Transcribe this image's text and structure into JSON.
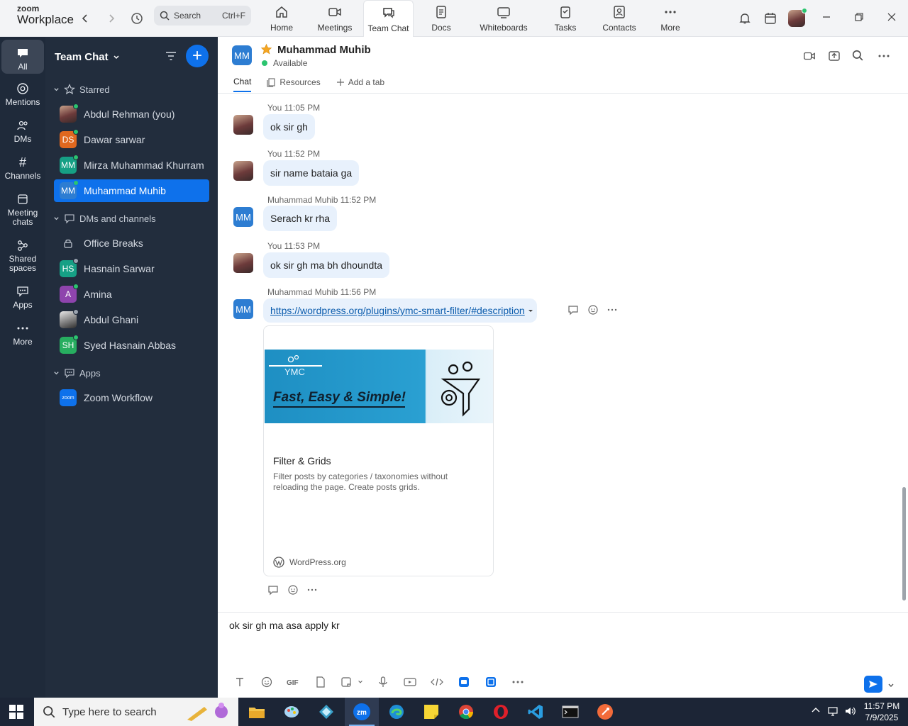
{
  "app": {
    "logo_line1": "zoom",
    "logo_line2": "Workplace"
  },
  "search": {
    "label": "Search",
    "shortcut": "Ctrl+F"
  },
  "nav": [
    {
      "label": "Home",
      "icon": "home-icon"
    },
    {
      "label": "Meetings",
      "icon": "video-icon"
    },
    {
      "label": "Team Chat",
      "icon": "chat-icon"
    },
    {
      "label": "Docs",
      "icon": "doc-icon"
    },
    {
      "label": "Whiteboards",
      "icon": "whiteboard-icon"
    },
    {
      "label": "Tasks",
      "icon": "tasks-icon"
    },
    {
      "label": "Contacts",
      "icon": "contacts-icon"
    },
    {
      "label": "More",
      "icon": "more-icon"
    }
  ],
  "rail": [
    {
      "label": "All"
    },
    {
      "label": "Mentions"
    },
    {
      "label": "DMs"
    },
    {
      "label": "Channels"
    },
    {
      "label": "Meeting chats"
    },
    {
      "label": "Shared spaces"
    },
    {
      "label": "Apps"
    },
    {
      "label": "More"
    }
  ],
  "sidebar": {
    "title": "Team Chat",
    "starred_label": "Starred",
    "starred": [
      {
        "name": "Abdul Rehman (you)",
        "initials": ""
      },
      {
        "name": "Dawar sarwar",
        "initials": "DS"
      },
      {
        "name": "Mirza Muhammad Khurram",
        "initials": "MM"
      },
      {
        "name": "Muhammad Muhib",
        "initials": "MM"
      }
    ],
    "dms_label": "DMs and channels",
    "dms": [
      {
        "name": "Office Breaks",
        "initials": ""
      },
      {
        "name": "Hasnain Sarwar",
        "initials": "HS"
      },
      {
        "name": "Amina",
        "initials": "A"
      },
      {
        "name": "Abdul Ghani",
        "initials": ""
      },
      {
        "name": "Syed Hasnain Abbas",
        "initials": "SH"
      }
    ],
    "apps_label": "Apps",
    "apps": [
      {
        "name": "Zoom Workflow",
        "initials": "zoom"
      }
    ]
  },
  "chat": {
    "contact_initials": "MM",
    "contact_name": "Muhammad Muhib",
    "status": "Available",
    "tabs": {
      "chat": "Chat",
      "resources": "Resources",
      "add": "Add a tab"
    },
    "messages": [
      {
        "sender": "You",
        "time": "11:05 PM",
        "text": "ok sir gh"
      },
      {
        "sender": "You",
        "time": "11:52 PM",
        "text": "sir name bataia ga"
      },
      {
        "sender": "Muhammad Muhib",
        "time": "11:52 PM",
        "text": "Serach kr rha"
      },
      {
        "sender": "You",
        "time": "11:53 PM",
        "text": "ok sir gh ma bh dhoundta"
      },
      {
        "sender": "Muhammad Muhib",
        "time": "11:56 PM",
        "text": "https://wordpress.org/plugins/ymc-smart-filter/#description"
      }
    ],
    "preview": {
      "brand": "YMC",
      "slogan": "Fast, Easy & Simple!",
      "title": "Filter & Grids",
      "description": "Filter posts by categories / taxonomies without reloading the page. Create posts grids.",
      "source": "WordPress.org"
    },
    "composer_text": "ok sir gh ma asa apply kr"
  },
  "taskbar": {
    "search_placeholder": "Type here to search",
    "time": "11:57 PM",
    "date": "7/9/2025"
  }
}
